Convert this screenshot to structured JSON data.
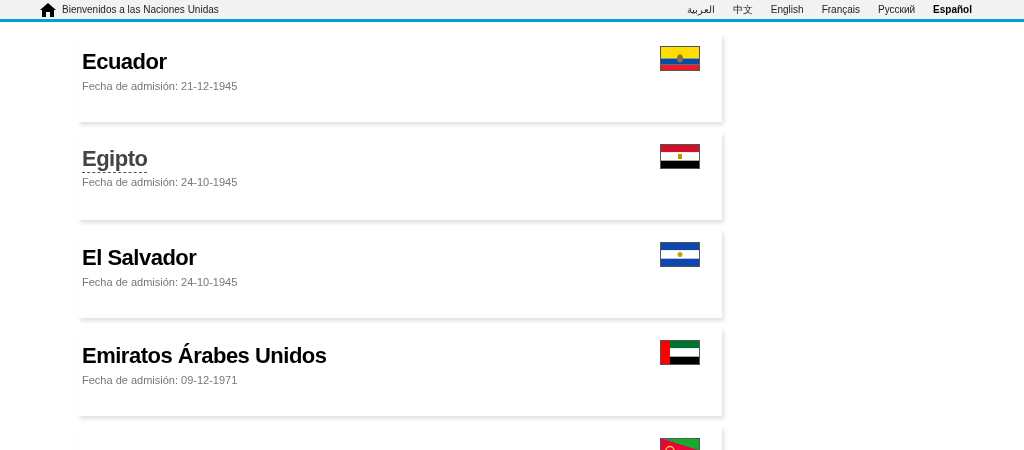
{
  "top_bar": {
    "home_label": "Bienvenidos a las Naciones Unidas",
    "languages": [
      {
        "label": "العربية",
        "selected": false
      },
      {
        "label": "中文",
        "selected": false
      },
      {
        "label": "English",
        "selected": false
      },
      {
        "label": "Français",
        "selected": false
      },
      {
        "label": "Русский",
        "selected": false
      },
      {
        "label": "Español",
        "selected": true
      }
    ]
  },
  "countries": [
    {
      "name": "Ecuador",
      "admission": "Fecha de admisión: 21-12-1945",
      "flag": {
        "kind": "ecuador"
      },
      "hovered": false
    },
    {
      "name": "Egipto",
      "admission": "Fecha de admisión: 24-10-1945",
      "flag": {
        "kind": "egypt"
      },
      "hovered": true
    },
    {
      "name": "El Salvador",
      "admission": "Fecha de admisión: 24-10-1945",
      "flag": {
        "kind": "el_salvador"
      },
      "hovered": false
    },
    {
      "name": "Emiratos Árabes Unidos",
      "admission": "Fecha de admisión: 09-12-1971",
      "flag": {
        "kind": "uae"
      },
      "hovered": false
    },
    {
      "flag": {
        "kind": "eritrea"
      }
    }
  ]
}
